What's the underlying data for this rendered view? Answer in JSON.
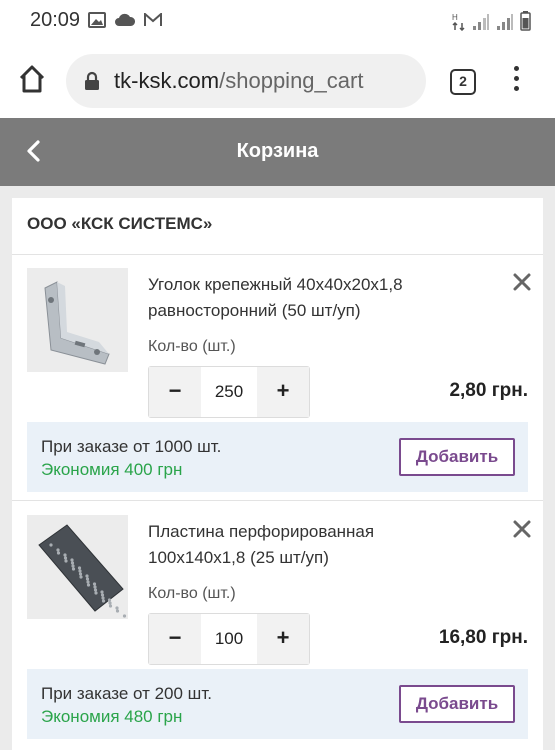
{
  "status_bar": {
    "time": "20:09",
    "icons": [
      "image-icon",
      "cloud-icon",
      "gmail-icon",
      "data-arrows-icon",
      "signal-icon",
      "signal-icon",
      "battery-icon"
    ]
  },
  "browser": {
    "url_domain": "tk-ksk.com",
    "url_path": "/shopping_cart",
    "tab_count": "2"
  },
  "header": {
    "title": "Корзина"
  },
  "cart": {
    "seller": "ООО «КСК СИСТЕМС»",
    "items": [
      {
        "name": "Уголок крепежный 40х40х20х1,8 равносторонний (50 шт/уп)",
        "qty_label": "Кол-во (шт.)",
        "qty": "250",
        "price": "2,80 грн.",
        "promo_text": "При заказе от 1000 шт.",
        "promo_saving": "Экономия 400 грн",
        "add_label": "Добавить"
      },
      {
        "name": "Пластина перфорированная 100х140х1,8 (25 шт/уп)",
        "qty_label": "Кол-во (шт.)",
        "qty": "100",
        "price": "16,80 грн.",
        "promo_text": "При заказе от 200 шт.",
        "promo_saving": "Экономия 480 грн",
        "add_label": "Добавить"
      }
    ]
  },
  "stepper": {
    "minus": "−",
    "plus": "+"
  },
  "colors": {
    "header_bg": "#7b7b7b",
    "accent": "#7a4a8e",
    "saving": "#2aa44a",
    "promo_bg": "#eaf1f8"
  }
}
